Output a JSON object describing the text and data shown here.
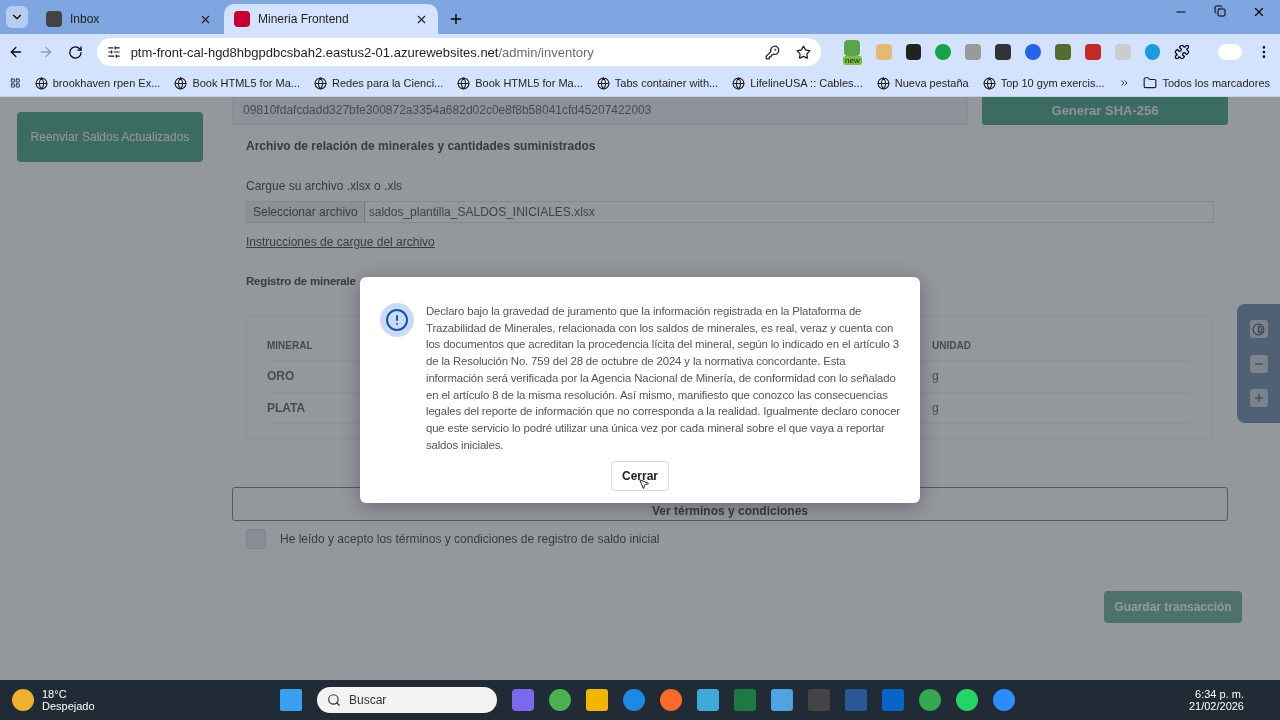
{
  "browser": {
    "tabs": [
      {
        "title": "Inbox",
        "selected": false
      },
      {
        "title": "Mineria Frontend",
        "selected": true
      }
    ],
    "url": {
      "host": "ptm-front-cal-hgd8hbgpdbcsbah2.eastus2-01.azurewebsites.net",
      "path": "/admin/inventory"
    },
    "bookmarks": [
      "brookhaven rpen Ex...",
      "Book HTML5 for Ma...",
      "Redes para la Cienci...",
      "Book HTML5 for Ma...",
      "Tabs container with...",
      "LifelineUSA :: Cables...",
      "Nueva pestaña",
      "Top 10 gym exercis..."
    ],
    "all_bookmarks": "Todos los marcadores",
    "extension_badge": "new"
  },
  "page": {
    "sidebar_button": "Reenviar Saldos Actualizados",
    "hash_value": "09810fdafcdadd327bfe300872a3354a682d02c0e8f8b58041cfd45207422003",
    "sha_button": "Generar SHA-256",
    "file_section": {
      "heading": "Archivo de relación de minerales y cantidades suministrados",
      "label": "Cargue su archivo .xlsx o .xls",
      "file_button": "Seleccionar archivo",
      "file_name": "saldos_plantilla_SALDOS_INICIALES.xlsx",
      "instructions_link": "Instrucciones de cargue del archivo"
    },
    "registry_heading": "Registro de minerale",
    "table": {
      "columns": [
        "MINERAL",
        "UNIDAD"
      ],
      "rows": [
        [
          "ORO",
          "g"
        ],
        [
          "PLATA",
          "g"
        ]
      ]
    },
    "terms_button": "Ver términos y condiciones",
    "accept": {
      "label": "He leído y acepto los términos y condiciones de registro de saldo inicial",
      "checked": false
    },
    "save_button": {
      "label": "Guardar transacción",
      "disabled": true
    }
  },
  "modal": {
    "message": "Declaro bajo la gravedad de juramento que la información registrada en la Plataforma de Trazabilidad de Minerales, relacionada con los saldos de minerales, es real, veraz y cuenta con los documentos que acreditan la procedencia lícita del mineral, según lo indicado en el artículo 3 de la Resolución No. 759 del 28 de octubre de 2024 y la normativa concordante. Esta información será verificada por la Agencia Nacional de Minería, de conformidad con lo señalado en el artículo 8 de la misma resolución. Así mismo, manifiesto que conozco las consecuencias legales del reporte de información que no corresponda a la realidad. Igualmente declaro conocer que este servicio lo podré utilizar una única vez por cada mineral sobre el que vaya a reportar saldos iniciales.",
    "close_button": "Cerrar"
  },
  "taskbar": {
    "temperature": "18°C",
    "weather": "Despejado",
    "search_placeholder": "Buscar",
    "time": "6:34 p. m.",
    "date": "21/02/2026"
  }
}
